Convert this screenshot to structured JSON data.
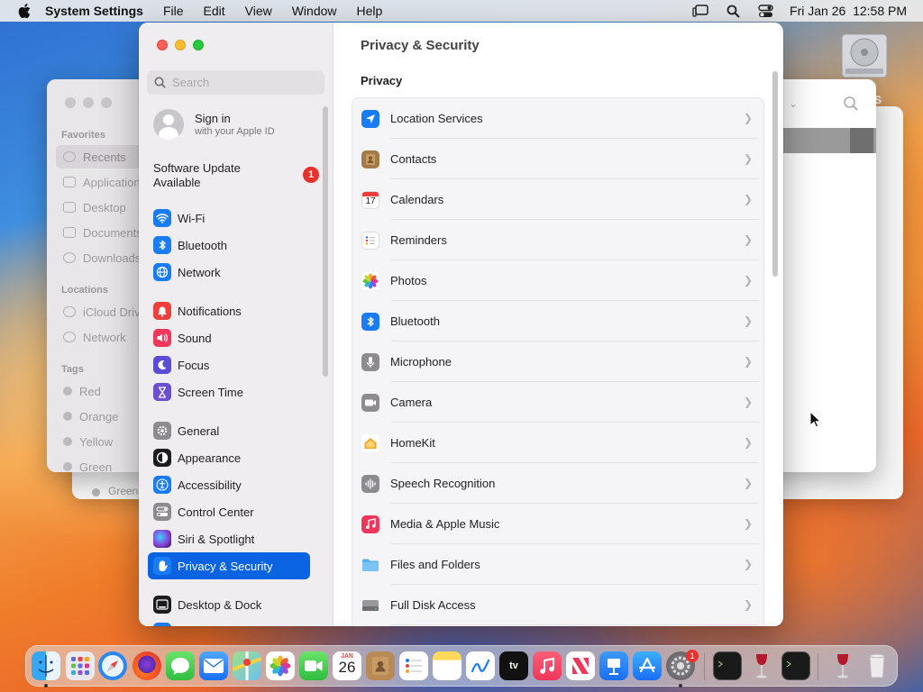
{
  "menubar": {
    "app_name": "System Settings",
    "menus": [
      "File",
      "Edit",
      "View",
      "Window",
      "Help"
    ],
    "clock": "Fri Jan 26  12:58 PM",
    "status_icons": [
      "stage-manager-icon",
      "spotlight-search-icon",
      "control-center-icon"
    ]
  },
  "desktop": {
    "drive_label": "S"
  },
  "finder_back": {
    "favorites_header": "Favorites",
    "favorites": [
      "Recents",
      "Applications",
      "Desktop",
      "Documents",
      "Downloads"
    ],
    "locations_header": "Locations",
    "locations": [
      "iCloud Drive",
      "Network"
    ],
    "tags_header": "Tags",
    "tags": [
      "Red",
      "Orange",
      "Yellow",
      "Green"
    ],
    "ghost_tag": "Green"
  },
  "settings": {
    "search_placeholder": "Search",
    "account": {
      "title": "Sign in",
      "subtitle": "with your Apple ID"
    },
    "update": {
      "label": "Software Update Available",
      "badge": "1"
    },
    "sidebar": [
      {
        "label": "Wi-Fi",
        "icon": "wifi-icon",
        "color": "#1a7cf5"
      },
      {
        "label": "Bluetooth",
        "icon": "bluetooth-icon",
        "color": "#1a7cf5"
      },
      {
        "label": "Network",
        "icon": "globe-icon",
        "color": "#1a7cf5"
      },
      {
        "label": "Notifications",
        "icon": "bell-icon",
        "color": "#ef3f3a"
      },
      {
        "label": "Sound",
        "icon": "speaker-icon",
        "color": "#f0365a"
      },
      {
        "label": "Focus",
        "icon": "moon-icon",
        "color": "#5b4bd6"
      },
      {
        "label": "Screen Time",
        "icon": "hourglass-icon",
        "color": "#6a4ed4"
      },
      {
        "label": "General",
        "icon": "gear-icon",
        "color": "#8d8b90"
      },
      {
        "label": "Appearance",
        "icon": "appearance-icon",
        "color": "#1c1c1e"
      },
      {
        "label": "Accessibility",
        "icon": "accessibility-icon",
        "color": "#1a7cf5"
      },
      {
        "label": "Control Center",
        "icon": "toggles-icon",
        "color": "#8d8b90"
      },
      {
        "label": "Siri & Spotlight",
        "icon": "siri-icon",
        "color": "#9a3fd0"
      },
      {
        "label": "Privacy & Security",
        "icon": "hand-icon",
        "color": "#1a7cf5"
      },
      {
        "label": "Desktop & Dock",
        "icon": "dock-icon",
        "color": "#1c1c1e"
      }
    ],
    "selected": "Privacy & Security",
    "pane_title": "Privacy & Security",
    "section_title": "Privacy",
    "privacy_items": [
      {
        "label": "Location Services",
        "icon": "location-arrow-icon",
        "color": "#1a7cf5"
      },
      {
        "label": "Contacts",
        "icon": "contacts-icon",
        "color": "#a57a4a"
      },
      {
        "label": "Calendars",
        "icon": "calendar-icon",
        "color": "#ffffff",
        "glyph": "17"
      },
      {
        "label": "Reminders",
        "icon": "reminders-icon",
        "color": "#ffffff"
      },
      {
        "label": "Photos",
        "icon": "photos-icon",
        "color": "#ffffff"
      },
      {
        "label": "Bluetooth",
        "icon": "bluetooth-icon",
        "color": "#1a7cf5"
      },
      {
        "label": "Microphone",
        "icon": "microphone-icon",
        "color": "#8d8b90"
      },
      {
        "label": "Camera",
        "icon": "camera-icon",
        "color": "#8d8b90"
      },
      {
        "label": "HomeKit",
        "icon": "home-icon",
        "color": "#ffffff"
      },
      {
        "label": "Speech Recognition",
        "icon": "waveform-icon",
        "color": "#8d8b90"
      },
      {
        "label": "Media & Apple Music",
        "icon": "music-note-icon",
        "color": "#f0365a"
      },
      {
        "label": "Files and Folders",
        "icon": "folder-icon",
        "color": "#5ab0ef"
      },
      {
        "label": "Full Disk Access",
        "icon": "disk-icon",
        "color": "#8d8b90"
      }
    ]
  },
  "dock": {
    "apps": [
      "Finder",
      "Launchpad",
      "Safari",
      "Firefox",
      "Messages",
      "Mail",
      "Maps",
      "Photos",
      "FaceTime",
      "Calendar",
      "Contacts",
      "Reminders",
      "Notes",
      "Freeform",
      "TV",
      "Music",
      "News",
      "Keynote",
      "App Store",
      "System Settings",
      "Terminal",
      "Wine",
      "Terminal",
      "Wine",
      "Trash"
    ],
    "calendar_month": "JAN",
    "calendar_day": "26",
    "settings_badge": "1",
    "tv_label": "tv"
  }
}
